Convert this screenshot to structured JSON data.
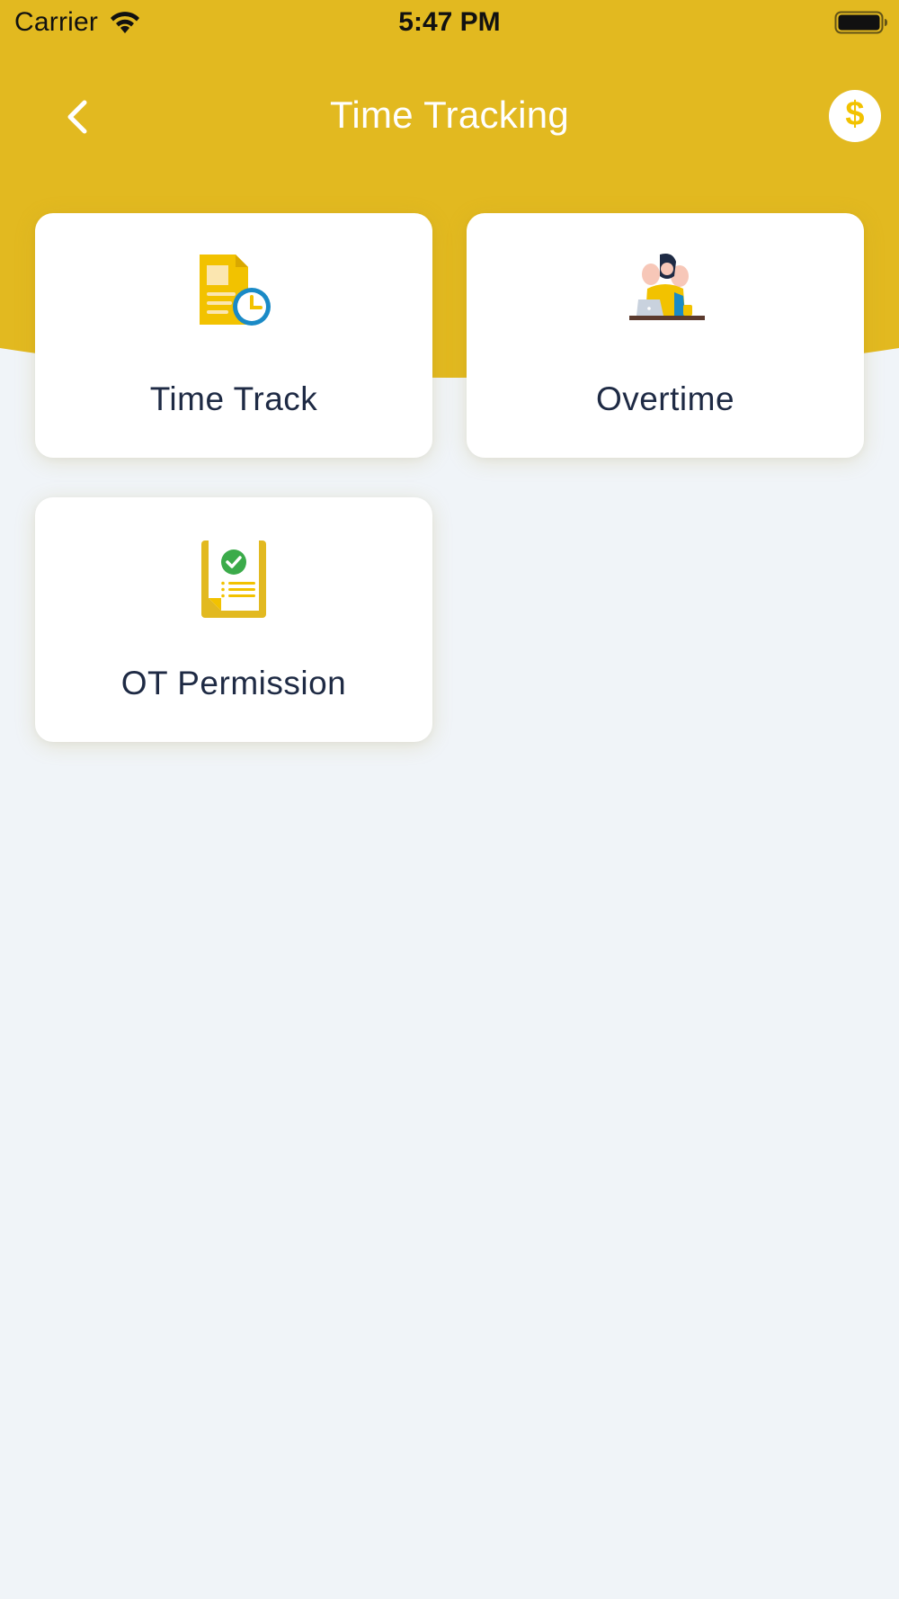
{
  "status_bar": {
    "carrier": "Carrier",
    "time": "5:47 PM"
  },
  "nav": {
    "title": "Time Tracking",
    "coin_symbol": "$"
  },
  "cards": [
    {
      "label": "Time Track",
      "icon": "time-track-document-icon"
    },
    {
      "label": "Overtime",
      "icon": "overtime-worker-icon"
    },
    {
      "label": "OT Permission",
      "icon": "ot-permission-clipboard-icon"
    }
  ],
  "colors": {
    "header": "#e2b920",
    "background": "#f0f4f8",
    "card": "#ffffff",
    "text": "#1e2a44",
    "accent_yellow": "#f2c200",
    "clock_blue": "#1a8ac6",
    "check_green": "#3bab4a"
  }
}
